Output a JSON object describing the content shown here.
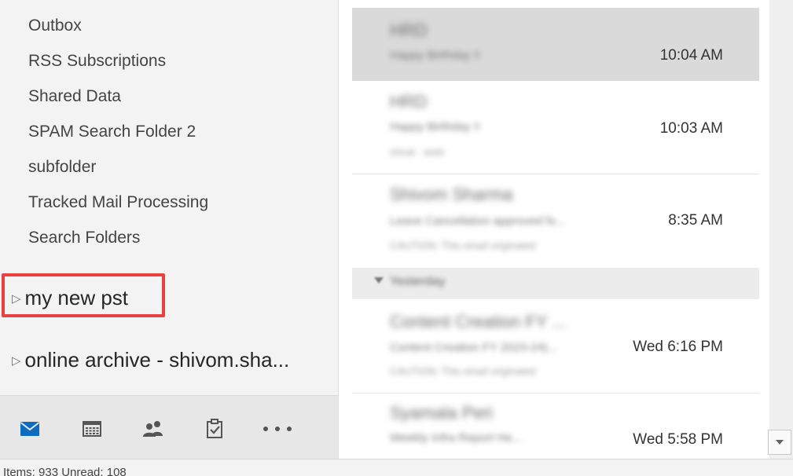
{
  "folders": [
    {
      "label": "Outbox"
    },
    {
      "label": "RSS Subscriptions"
    },
    {
      "label": "Shared Data"
    },
    {
      "label": "SPAM Search Folder 2"
    },
    {
      "label": "subfolder"
    },
    {
      "label": "Tracked Mail Processing"
    },
    {
      "label": "Search Folders"
    }
  ],
  "stores": [
    {
      "label": "my new pst",
      "highlighted": true
    },
    {
      "label": "online archive - shivom.sha..."
    }
  ],
  "nav": {
    "items": [
      "mail-icon",
      "calendar-icon",
      "people-icon",
      "tasks-icon",
      "more-icon"
    ],
    "accent": "#0f6cbd"
  },
  "messages": [
    {
      "sender": "HRD",
      "subject": "Happy Birthday !!",
      "preview": "",
      "time": "10:04 AM",
      "selected": true
    },
    {
      "sender": "HRD",
      "subject": "Happy Birthday !!",
      "preview": "shruti · wish",
      "time": "10:03 AM",
      "selected": false
    },
    {
      "sender": "Shivom Sharma",
      "subject": "Leave Cancellation approved fo...",
      "preview": "CAUTION: This email originated",
      "time": "8:35 AM",
      "selected": false
    },
    {
      "sender": "Content Creation FY ...",
      "subject": "Content Creation FY 2023-24)...",
      "preview": "CAUTION: This email originated",
      "time": "Wed 6:16 PM",
      "selected": false
    },
    {
      "sender": "Syamala Peri",
      "subject": "Weekly Infra Report He...",
      "preview": "",
      "time": "Wed 5:58 PM",
      "selected": false
    }
  ],
  "group_header": {
    "label": "Yesterday"
  },
  "status": {
    "text": "Items: 933    Unread: 108"
  },
  "colors": {
    "highlight_border": "#e8413f",
    "selected_row": "#dadada",
    "folder_pane_bg": "#f3f3f3"
  }
}
